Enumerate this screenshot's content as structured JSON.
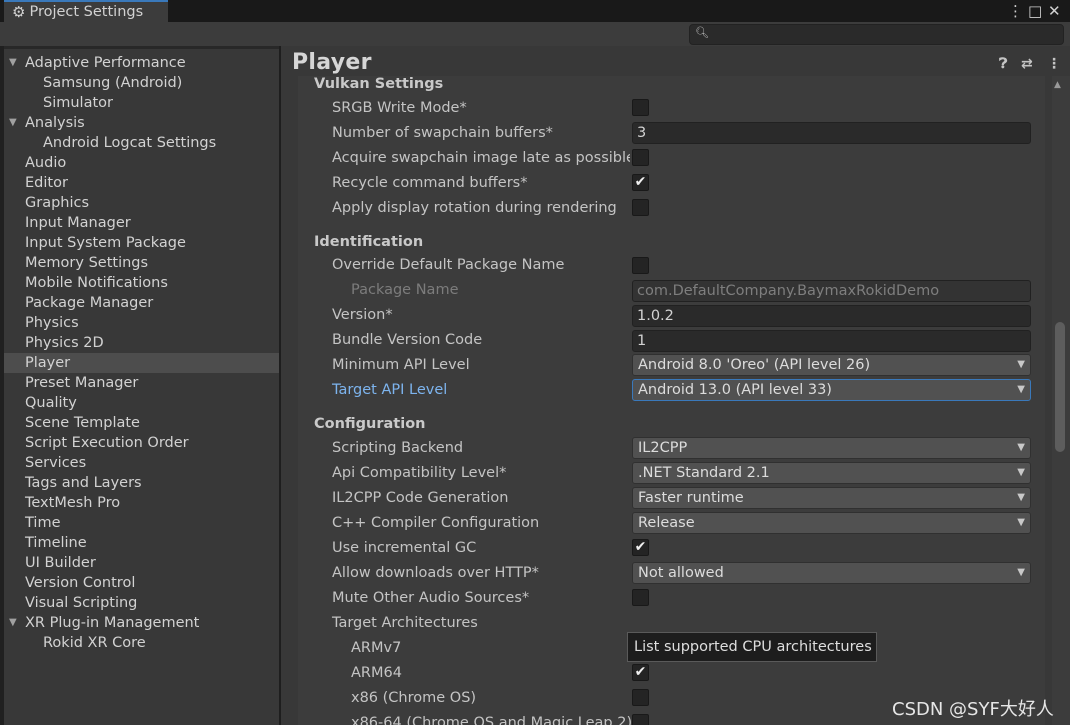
{
  "window": {
    "tab_title": "Project Settings",
    "controls": [
      "⋮",
      "□",
      "✕"
    ]
  },
  "search": {
    "placeholder": ""
  },
  "nav": {
    "items": [
      {
        "label": "Adaptive Performance",
        "expandable": true
      },
      {
        "label": "Samsung (Android)",
        "child": true
      },
      {
        "label": "Simulator",
        "child": true
      },
      {
        "label": "Analysis",
        "expandable": true
      },
      {
        "label": "Android Logcat Settings",
        "child": true
      },
      {
        "label": "Audio"
      },
      {
        "label": "Editor"
      },
      {
        "label": "Graphics"
      },
      {
        "label": "Input Manager"
      },
      {
        "label": "Input System Package"
      },
      {
        "label": "Memory Settings"
      },
      {
        "label": "Mobile Notifications"
      },
      {
        "label": "Package Manager"
      },
      {
        "label": "Physics"
      },
      {
        "label": "Physics 2D"
      },
      {
        "label": "Player",
        "selected": true
      },
      {
        "label": "Preset Manager"
      },
      {
        "label": "Quality"
      },
      {
        "label": "Scene Template"
      },
      {
        "label": "Script Execution Order"
      },
      {
        "label": "Services"
      },
      {
        "label": "Tags and Layers"
      },
      {
        "label": "TextMesh Pro"
      },
      {
        "label": "Time"
      },
      {
        "label": "Timeline"
      },
      {
        "label": "UI Builder"
      },
      {
        "label": "Version Control"
      },
      {
        "label": "Visual Scripting"
      },
      {
        "label": "XR Plug-in Management",
        "expandable": true
      },
      {
        "label": "Rokid XR Core",
        "child": true
      }
    ]
  },
  "panel": {
    "title": "Player",
    "icons": [
      "help-icon",
      "preset-icon",
      "more-icon"
    ]
  },
  "vulkan": {
    "heading": "Vulkan Settings",
    "srgb_label": "SRGB Write Mode*",
    "srgb_checked": false,
    "swapchain_label": "Number of swapchain buffers*",
    "swapchain_value": "3",
    "acquire_label": "Acquire swapchain image late as possible*",
    "acquire_checked": false,
    "recycle_label": "Recycle command buffers*",
    "recycle_checked": true,
    "rotation_label": "Apply display rotation during rendering",
    "rotation_checked": false
  },
  "identification": {
    "heading": "Identification",
    "override_label": "Override Default Package Name",
    "override_checked": false,
    "package_name_label": "Package Name",
    "package_name_value": "com.DefaultCompany.BaymaxRokidDemo",
    "version_label": "Version*",
    "version_value": "1.0.2",
    "bundle_label": "Bundle Version Code",
    "bundle_value": "1",
    "min_api_label": "Minimum API Level",
    "min_api_value": "Android 8.0 'Oreo' (API level 26)",
    "target_api_label": "Target API Level",
    "target_api_value": "Android 13.0 (API level 33)"
  },
  "configuration": {
    "heading": "Configuration",
    "backend_label": "Scripting Backend",
    "backend_value": "IL2CPP",
    "api_compat_label": "Api Compatibility Level*",
    "api_compat_value": ".NET Standard 2.1",
    "codegen_label": "IL2CPP Code Generation",
    "codegen_value": "Faster runtime",
    "compiler_label": "C++ Compiler Configuration",
    "compiler_value": "Release",
    "incremental_gc_label": "Use incremental GC",
    "incremental_gc_checked": true,
    "http_label": "Allow downloads over HTTP*",
    "http_value": "Not allowed",
    "mute_label": "Mute Other Audio Sources*",
    "mute_checked": false,
    "arch_label": "Target Architectures",
    "armv7_label": "ARMv7",
    "arm64_label": "ARM64",
    "arm64_checked": true,
    "x86_label": "x86 (Chrome OS)",
    "x86_checked": false,
    "x86_64_label": "x86-64 (Chrome OS and Magic Leap 2)"
  },
  "tooltip": "List supported CPU architectures",
  "watermark": "CSDN @SYF大好人"
}
